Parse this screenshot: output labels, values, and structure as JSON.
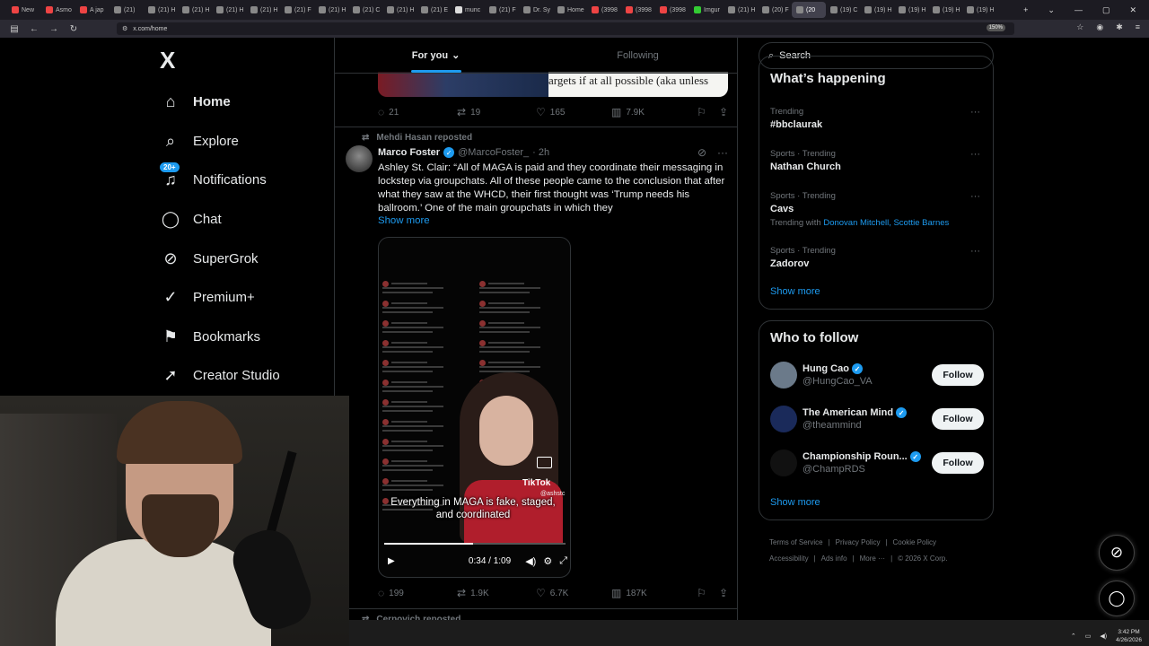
{
  "browser": {
    "tabs": [
      {
        "label": "New",
        "color": "#e44"
      },
      {
        "label": "Asmo",
        "color": "#e44"
      },
      {
        "label": "A jap",
        "color": "#e44"
      },
      {
        "label": "(21)",
        "color": "#888"
      },
      {
        "label": "(21) H",
        "color": "#888"
      },
      {
        "label": "(21) H",
        "color": "#888"
      },
      {
        "label": "(21) H",
        "color": "#888"
      },
      {
        "label": "(21) H",
        "color": "#888"
      },
      {
        "label": "(21) F",
        "color": "#888"
      },
      {
        "label": "(21) H",
        "color": "#888"
      },
      {
        "label": "(21) C",
        "color": "#888"
      },
      {
        "label": "(21) H",
        "color": "#888"
      },
      {
        "label": "(21) E",
        "color": "#888"
      },
      {
        "label": "munc",
        "color": "#ddd"
      },
      {
        "label": "(21) F",
        "color": "#888"
      },
      {
        "label": "Dr. Sy",
        "color": "#888"
      },
      {
        "label": "Home",
        "color": "#888"
      },
      {
        "label": "(3998",
        "color": "#e44"
      },
      {
        "label": "(3998",
        "color": "#e44"
      },
      {
        "label": "(3998",
        "color": "#e44"
      },
      {
        "label": "Imgur",
        "color": "#3c3"
      },
      {
        "label": "(21) H",
        "color": "#888"
      },
      {
        "label": "(20) F",
        "color": "#888"
      },
      {
        "label": "(20",
        "color": "#888",
        "active": true
      },
      {
        "label": "(19) C",
        "color": "#888"
      },
      {
        "label": "(19) H",
        "color": "#888"
      },
      {
        "label": "(19) H",
        "color": "#888"
      },
      {
        "label": "(19) H",
        "color": "#888"
      },
      {
        "label": "(19) H",
        "color": "#888"
      }
    ],
    "url": "x.com/home",
    "zoom": "150%"
  },
  "nav": {
    "logo": "X",
    "items": [
      {
        "label": "Home",
        "icon": "home-icon",
        "glyph": "⌂",
        "active": true
      },
      {
        "label": "Explore",
        "icon": "search-icon",
        "glyph": "⌕"
      },
      {
        "label": "Notifications",
        "icon": "bell-icon",
        "glyph": "♫",
        "badge": "20+"
      },
      {
        "label": "Chat",
        "icon": "chat-icon",
        "glyph": "◯"
      },
      {
        "label": "SuperGrok",
        "icon": "grok-icon",
        "glyph": "⊘"
      },
      {
        "label": "Premium+",
        "icon": "premium-icon",
        "glyph": "✓"
      },
      {
        "label": "Bookmarks",
        "icon": "bookmark-icon",
        "glyph": "⚑"
      },
      {
        "label": "Creator Studio",
        "icon": "rocket-icon",
        "glyph": "➚"
      }
    ]
  },
  "timeline": {
    "tabs": [
      "For you",
      "Following"
    ],
    "prev_tweet": {
      "image_text": "argets if at all possible (aka unless",
      "replies": "21",
      "reposts": "19",
      "likes": "165",
      "views": "7.9K"
    },
    "tweet": {
      "repost_label": "Mehdi Hasan reposted",
      "name": "Marco Foster",
      "handle": "@MarcoFoster_",
      "time": "· 2h",
      "text": "Ashley St. Clair: “All of MAGA is paid and they coordinate their messaging in lockstep via groupchats. All of these people came to the conclusion that after what they saw at the WHCD, their first thought was ‘Trump needs his ballroom.’ One of the main groupchats in which they",
      "show_more": "Show more",
      "video": {
        "caption": "Everything in MAGA is fake, staged, and coordinated",
        "brand": "TikTok",
        "brand_handle": "@ashstc",
        "time": "0:34 / 1:09",
        "progress": 0.49
      },
      "replies": "199",
      "reposts": "1.9K",
      "likes": "6.7K",
      "views": "187K"
    },
    "next_repost_label": "Cernovich reposted"
  },
  "right": {
    "search_placeholder": "Search",
    "happening": {
      "title": "What’s happening",
      "trends": [
        {
          "meta": "Trending",
          "topic": "#bbclaurak"
        },
        {
          "meta": "Sports · Trending",
          "topic": "Nathan Church"
        },
        {
          "meta": "Sports · Trending",
          "topic": "Cavs",
          "with_label": "Trending with",
          "with_names": "Donovan Mitchell, Scottie Barnes"
        },
        {
          "meta": "Sports · Trending",
          "topic": "Zadorov"
        }
      ],
      "show_more": "Show more"
    },
    "who_to_follow": {
      "title": "Who to follow",
      "accounts": [
        {
          "name": "Hung Cao",
          "handle": "@HungCao_VA",
          "avatar_color": "#6b7a8a"
        },
        {
          "name": "The American Mind",
          "handle": "@theammind",
          "avatar_color": "#1a2a5a"
        },
        {
          "name": "Championship Roun...",
          "handle": "@ChampRDS",
          "avatar_color": "#111111"
        }
      ],
      "follow_label": "Follow",
      "show_more": "Show more"
    },
    "footer": {
      "links": [
        "Terms of Service",
        "Privacy Policy",
        "Cookie Policy",
        "Accessibility",
        "Ads info",
        "More ···",
        "© 2026 X Corp."
      ]
    }
  },
  "system": {
    "time": "3:42 PM",
    "date": "4/26/2026"
  },
  "colors": {
    "accent": "#1d9bf0",
    "background": "#000000",
    "border": "#2f3336",
    "muted": "#71767b"
  }
}
